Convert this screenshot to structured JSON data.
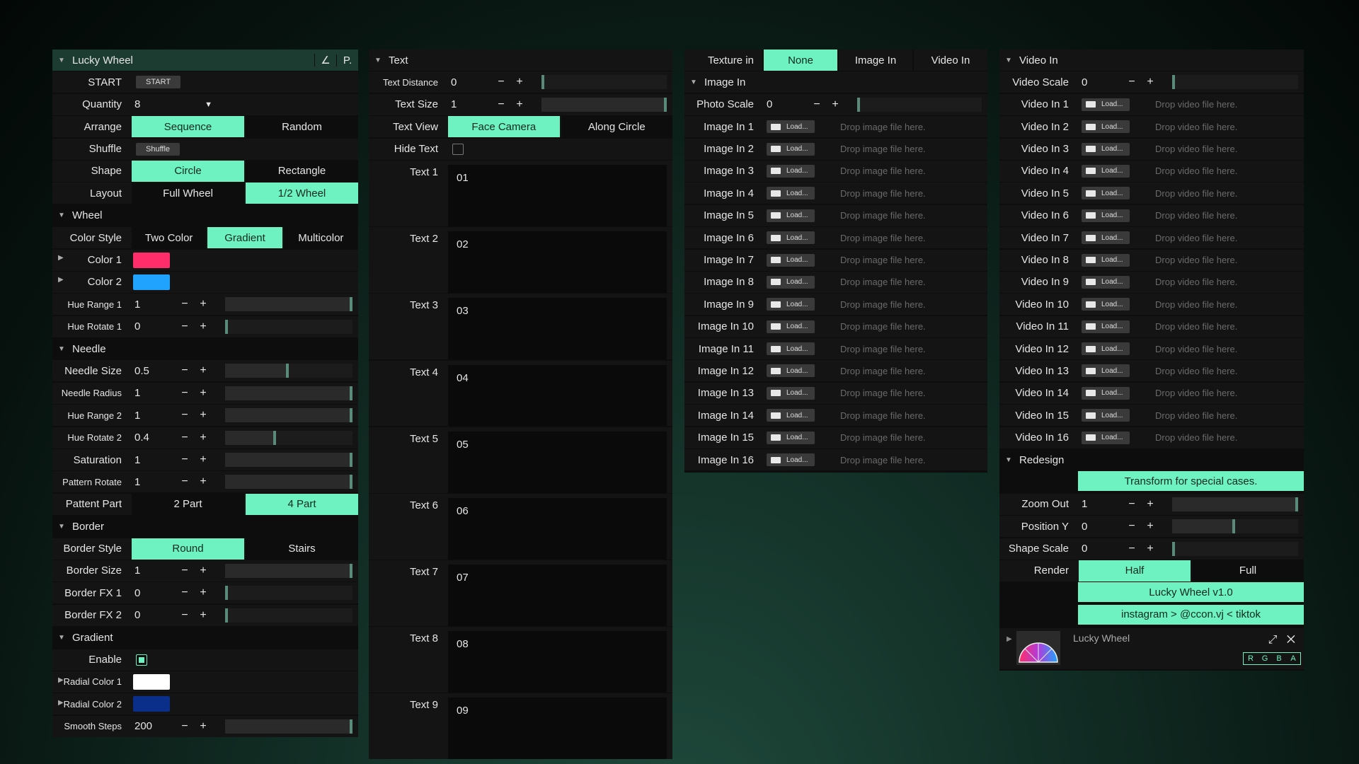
{
  "colors": {
    "accent": "#6ff2c2",
    "color1": "#ff2d6a",
    "color2": "#1fa3ff",
    "radial1": "#ffffff",
    "radial2": "#0a2f8a"
  },
  "p1": {
    "title": "Lucky Wheel",
    "title_btn1": "∠",
    "title_btn2": "P.",
    "start_label": "START",
    "start_btn": "START",
    "quantity_label": "Quantity",
    "quantity_value": "8",
    "arrange_label": "Arrange",
    "arrange_opts": [
      "Sequence",
      "Random"
    ],
    "shuffle_label": "Shuffle",
    "shuffle_btn": "Shuffle",
    "shape_label": "Shape",
    "shape_opts": [
      "Circle",
      "Rectangle"
    ],
    "layout_label": "Layout",
    "layout_opts": [
      "Full Wheel",
      "1/2 Wheel"
    ],
    "wheel_header": "Wheel",
    "colorstyle_label": "Color Style",
    "colorstyle_opts": [
      "Two Color",
      "Gradient",
      "Multicolor"
    ],
    "color1_label": "Color 1",
    "color2_label": "Color 2",
    "huerange1": {
      "label": "Hue Range 1",
      "value": "1"
    },
    "huerotate1": {
      "label": "Hue Rotate 1",
      "value": "0"
    },
    "needle_header": "Needle",
    "needlesize": {
      "label": "Needle Size",
      "value": "0.5"
    },
    "needleradius": {
      "label": "Needle Radius",
      "value": "1"
    },
    "huerange2": {
      "label": "Hue Range 2",
      "value": "1"
    },
    "huerotate2": {
      "label": "Hue Rotate 2",
      "value": "0.4"
    },
    "saturation": {
      "label": "Saturation",
      "value": "1"
    },
    "patternrotate": {
      "label": "Pattern Rotate",
      "value": "1"
    },
    "pattentpart_label": "Pattent Part",
    "pattentpart_opts": [
      "2 Part",
      "4 Part"
    ],
    "border_header": "Border",
    "borderstyle_label": "Border Style",
    "borderstyle_opts": [
      "Round",
      "Stairs"
    ],
    "bordersize": {
      "label": "Border Size",
      "value": "1"
    },
    "borderfx1": {
      "label": "Border FX 1",
      "value": "0"
    },
    "borderfx2": {
      "label": "Border FX 2",
      "value": "0"
    },
    "gradient_header": "Gradient",
    "enable_label": "Enable",
    "radial1_label": "Radial Color 1",
    "radial2_label": "Radial Color 2",
    "smoothsteps": {
      "label": "Smooth Steps",
      "value": "200"
    },
    "minus": "−",
    "plus": "+"
  },
  "p2": {
    "header": "Text",
    "textdistance": {
      "label": "Text Distance",
      "value": "0"
    },
    "textsize": {
      "label": "Text Size",
      "value": "1"
    },
    "textview_label": "Text View",
    "textview_opts": [
      "Face Camera",
      "Along Circle"
    ],
    "hidetext_label": "Hide Text",
    "texts": [
      {
        "label": "Text 1",
        "value": "01"
      },
      {
        "label": "Text 2",
        "value": "02"
      },
      {
        "label": "Text 3",
        "value": "03"
      },
      {
        "label": "Text 4",
        "value": "04"
      },
      {
        "label": "Text 5",
        "value": "05"
      },
      {
        "label": "Text 6",
        "value": "06"
      },
      {
        "label": "Text 7",
        "value": "07"
      },
      {
        "label": "Text 8",
        "value": "08"
      },
      {
        "label": "Text 9",
        "value": "09"
      }
    ]
  },
  "p3": {
    "texture_label": "Texture in",
    "texture_opts": [
      "None",
      "Image In",
      "Video In"
    ],
    "imagein_header": "Image In",
    "photoscale": {
      "label": "Photo Scale",
      "value": "0"
    },
    "load_label": "Load...",
    "drop_text": "Drop image file here.",
    "images": [
      "Image In 1",
      "Image In 2",
      "Image In 3",
      "Image In 4",
      "Image In 5",
      "Image In 6",
      "Image In 7",
      "Image In 8",
      "Image In 9",
      "Image In 10",
      "Image In 11",
      "Image In 12",
      "Image In 13",
      "Image In 14",
      "Image In 15",
      "Image In 16"
    ]
  },
  "p4": {
    "header": "Video In",
    "videoscale": {
      "label": "Video Scale",
      "value": "0"
    },
    "load_label": "Load...",
    "drop_text": "Drop video file here.",
    "videos": [
      "Video In 1",
      "Video In 2",
      "Video In 3",
      "Video In 4",
      "Video In 5",
      "Video In 6",
      "Video In 7",
      "Video In 8",
      "Video In 9",
      "Video In 10",
      "Video In 11",
      "Video In 12",
      "Video In 13",
      "Video In 14",
      "Video In 15",
      "Video In 16"
    ],
    "redesign_header": "Redesign",
    "transform_btn": "Transform for special cases.",
    "zoomout": {
      "label": "Zoom Out",
      "value": "1"
    },
    "positiony": {
      "label": "Position Y",
      "value": "0"
    },
    "shapescale": {
      "label": "Shape Scale",
      "value": "0"
    },
    "render_label": "Render",
    "render_opts": [
      "Half",
      "Full"
    ],
    "version_btn": "Lucky Wheel v1.0",
    "social_btn": "instagram > @ccon.vj < tiktok",
    "preview_title": "Lucky Wheel",
    "rgba": [
      "R",
      "G",
      "B",
      "A"
    ]
  }
}
